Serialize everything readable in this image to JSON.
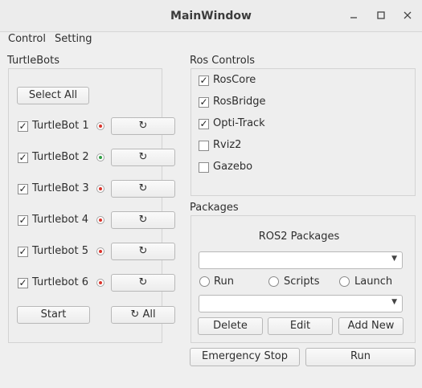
{
  "window": {
    "title": "MainWindow",
    "minimize": "🗕",
    "maximize": "☐",
    "close": "✕"
  },
  "menu": [
    "Control",
    "Setting"
  ],
  "turtlebots": {
    "label": "TurtleBots",
    "select_all": "Select All",
    "items": [
      {
        "name": "TurtleBot 1",
        "checked": true,
        "status_color": "#d9342b",
        "refresh": "↻"
      },
      {
        "name": "TurtleBot 2",
        "checked": true,
        "status_color": "#2f9e44",
        "refresh": "↻"
      },
      {
        "name": "TurtleBot 3",
        "checked": true,
        "status_color": "#d9342b",
        "refresh": "↻"
      },
      {
        "name": "Turtlebot 4",
        "checked": true,
        "status_color": "#d9342b",
        "refresh": "↻"
      },
      {
        "name": "Turtlebot 5",
        "checked": true,
        "status_color": "#d9342b",
        "refresh": "↻"
      },
      {
        "name": "Turtlebot 6",
        "checked": true,
        "status_color": "#d9342b",
        "refresh": "↻"
      }
    ],
    "start": "Start",
    "all": "↻ All"
  },
  "ros_controls": {
    "label": "Ros Controls",
    "items": [
      {
        "name": "RosCore",
        "checked": true
      },
      {
        "name": "RosBridge",
        "checked": true
      },
      {
        "name": "Opti-Track",
        "checked": true
      },
      {
        "name": "Rviz2",
        "checked": false
      },
      {
        "name": "Gazebo",
        "checked": false
      }
    ]
  },
  "packages": {
    "label": "Packages",
    "heading": "ROS2 Packages",
    "combo1_value": "",
    "combo2_value": "",
    "radios": [
      "Run",
      "Scripts",
      "Launch"
    ],
    "delete": "Delete",
    "edit": "Edit",
    "add_new": "Add New"
  },
  "bottom": {
    "emergency_stop": "Emergency Stop",
    "run": "Run"
  },
  "check_mark": "✓"
}
